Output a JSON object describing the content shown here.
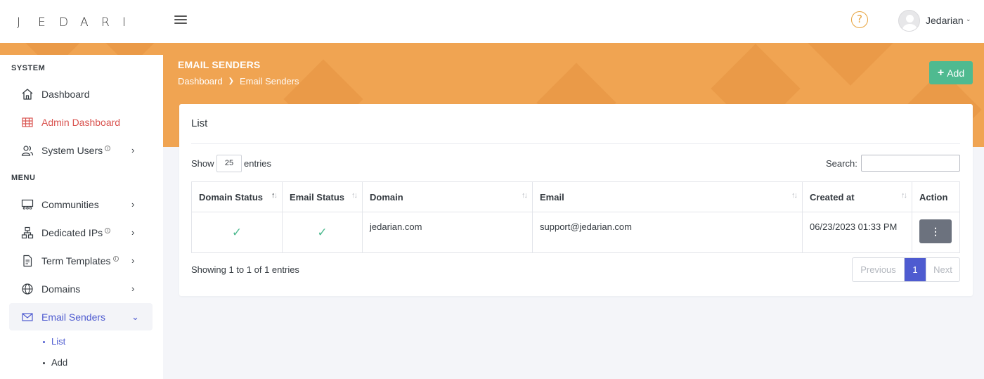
{
  "brand": {
    "logo_letters": [
      "J",
      "E",
      "D",
      "A",
      "R",
      "I"
    ]
  },
  "topbar": {
    "help_icon": "question-circle-icon",
    "user": {
      "name": "Jedarian"
    }
  },
  "sidebar": {
    "sections": [
      {
        "title": "SYSTEM"
      },
      {
        "title": "MENU"
      }
    ],
    "items": [
      {
        "label": "Dashboard",
        "icon": "home-icon"
      },
      {
        "label": "Admin Dashboard",
        "icon": "table-grid-icon"
      },
      {
        "label": "System Users",
        "icon": "users-icon"
      },
      {
        "label": "Communities",
        "icon": "community-icon"
      },
      {
        "label": "Dedicated IPs",
        "icon": "network-icon"
      },
      {
        "label": "Term Templates",
        "icon": "document-icon"
      },
      {
        "label": "Domains",
        "icon": "globe-icon"
      },
      {
        "label": "Email Senders",
        "icon": "envelope-icon"
      }
    ],
    "subitems": [
      {
        "label": "List"
      },
      {
        "label": "Add"
      }
    ],
    "info_badge": "i"
  },
  "header": {
    "title": "EMAIL SENDERS",
    "breadcrumb": [
      "Dashboard",
      "Email Senders"
    ],
    "add_button": "Add"
  },
  "card": {
    "title": "List",
    "length": {
      "show": "Show",
      "value": "25",
      "entries": "entries"
    },
    "search": {
      "label": "Search:",
      "value": ""
    },
    "columns": [
      "Domain Status",
      "Email Status",
      "Domain",
      "Email",
      "Created at",
      "Action"
    ],
    "rows": [
      {
        "domain_status": "✓",
        "email_status": "✓",
        "domain": "jedarian.com",
        "email": "support@jedarian.com",
        "created_at": "06/23/2023 01:33 PM",
        "action": "⋮"
      }
    ],
    "info": "Showing 1 to 1 of 1 entries",
    "pagination": {
      "previous": "Previous",
      "page": "1",
      "next": "Next"
    }
  },
  "colors": {
    "accent_orange": "#f0a452",
    "primary": "#4e5bd0",
    "success": "#4fba90",
    "danger": "#d9534f"
  }
}
